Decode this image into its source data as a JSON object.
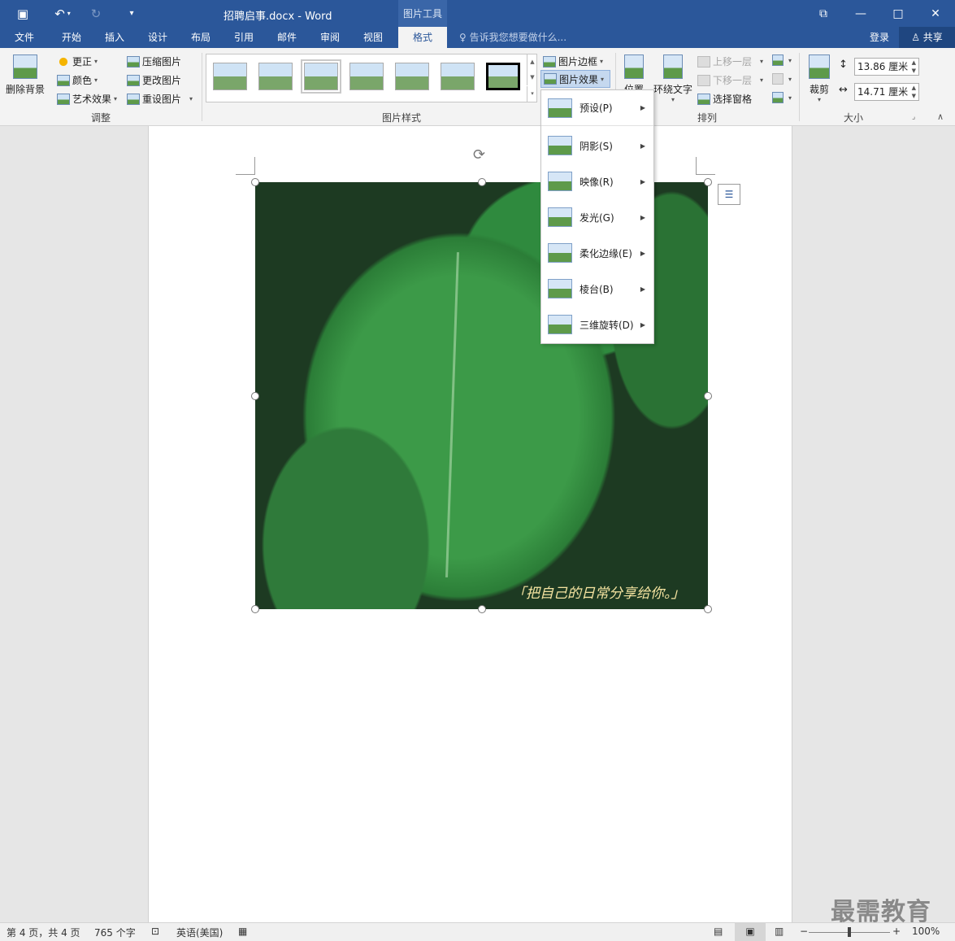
{
  "titlebar": {
    "title": "招聘启事.docx - Word",
    "context_tools": "图片工具",
    "save_icon": "save-icon",
    "undo_icon": "undo-icon",
    "redo_icon": "redo-icon",
    "customize_icon": "chevron-down-icon"
  },
  "tabs": [
    "文件",
    "开始",
    "插入",
    "设计",
    "布局",
    "引用",
    "邮件",
    "审阅",
    "视图",
    "格式"
  ],
  "tellme": "告诉我您想要做什么...",
  "account": {
    "login": "登录",
    "share": "共享"
  },
  "ribbon": {
    "adjust": {
      "remove_bg": "删除背景",
      "corrections": "更正",
      "color": "颜色",
      "artistic": "艺术效果",
      "compress": "压缩图片",
      "change": "更改图片",
      "reset": "重设图片",
      "label": "调整"
    },
    "styles": {
      "border": "图片边框",
      "effects": "图片效果",
      "label": "图片样式"
    },
    "arrange": {
      "position": "位置",
      "wrap": "环绕文字",
      "forward": "上移一层",
      "backward": "下移一层",
      "selection_pane": "选择窗格",
      "label": "排列"
    },
    "size": {
      "crop": "裁剪",
      "height": "13.86 厘米",
      "width": "14.71 厘米",
      "label": "大小"
    }
  },
  "effects_menu": [
    {
      "label": "预设(P)"
    },
    {
      "label": "阴影(S)"
    },
    {
      "label": "映像(R)"
    },
    {
      "label": "发光(G)"
    },
    {
      "label": "柔化边缘(E)"
    },
    {
      "label": "棱台(B)"
    },
    {
      "label": "三维旋转(D)"
    }
  ],
  "picture": {
    "caption": "「把自己的日常分享给你。」"
  },
  "statusbar": {
    "page": "第 4 页，共 4 页",
    "words": "765 个字",
    "language": "英语(美国)",
    "zoom": "100%"
  },
  "watermark": "最需教育"
}
